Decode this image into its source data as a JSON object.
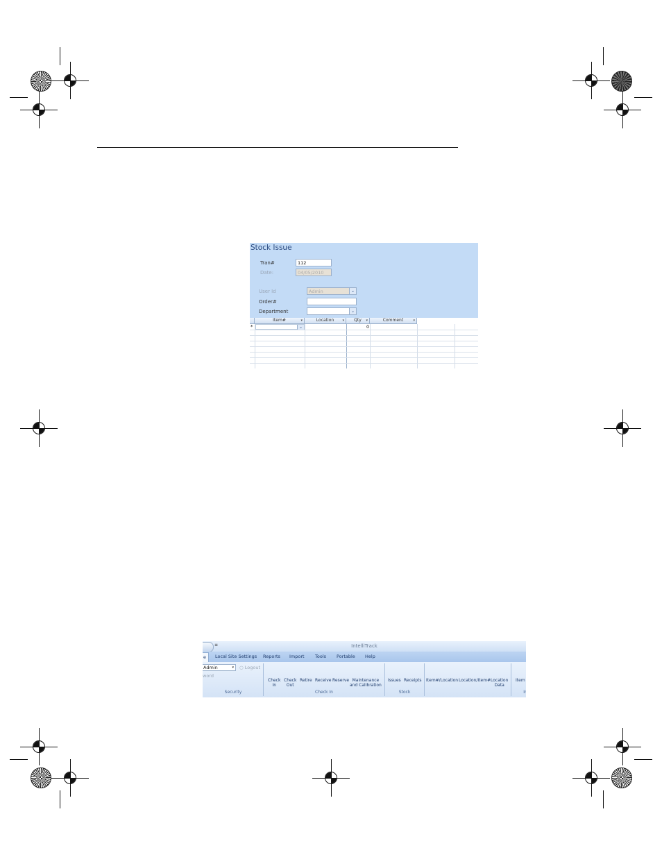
{
  "stock_issue": {
    "title": "Stock Issue",
    "tran_label": "Tran#",
    "tran_value": "112",
    "date_label": "Date:",
    "date_value": "04/05/2010",
    "user_id_label": "User Id",
    "user_id_value": "Admin",
    "order_label": "Order#",
    "department_label": "Department",
    "columns": [
      "Item#",
      "Location",
      "Qty",
      "Comment"
    ],
    "new_row_marker": "*",
    "qty_default": "0"
  },
  "ribbon": {
    "app_title": "IntelliTrack",
    "qat_glyph": "≡",
    "tabs": [
      "e",
      "Local Site Settings",
      "Reports",
      "Import",
      "Tools",
      "Portable",
      "Help"
    ],
    "user_value": "Admin",
    "logout_label": "Logout",
    "password_label": "word",
    "buttons": {
      "check_in": [
        "Check",
        "In"
      ],
      "check_out": [
        "Check",
        "Out"
      ],
      "retire": "Retire",
      "receive": "Receive",
      "reserve": "Reserve",
      "maintenance": [
        "Maintenance",
        "and Calibration"
      ],
      "issues": "Issues",
      "receipts": "Receipts",
      "item_location": "Item#/Location",
      "location_item": "Location/Item#",
      "location_data": [
        "Location",
        "Data"
      ],
      "item": "Item"
    },
    "groups": {
      "security": "Security",
      "check_in": "Check In",
      "stock": "Stock",
      "last": "In"
    }
  },
  "icons": {
    "dropdown": "dropdown-arrow-icon",
    "logout": "logout-icon"
  },
  "colors": {
    "form_background": "#c3dbf6",
    "ribbon_background": "#dbe8f8",
    "accent_text": "#1d3a6b"
  }
}
